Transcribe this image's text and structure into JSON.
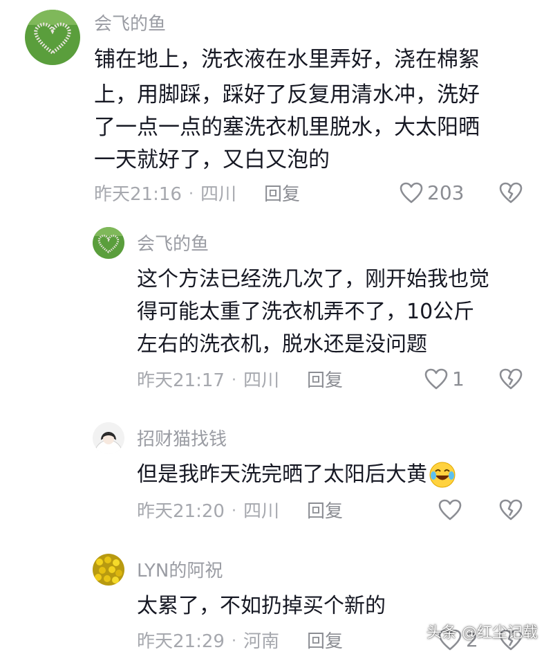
{
  "comments": [
    {
      "name": "会飞的鱼",
      "lines": [
        "铺在地上，洗衣液在水里弄好，浇在棉絮",
        "上，用脚踩，踩好了反复用清水冲，洗好",
        "了一点一点的塞洗衣机里脱水，大太阳晒",
        "一天就好了，又白又泡的"
      ],
      "time": "昨天21:16",
      "location": "四川",
      "reply_label": "回复",
      "likes": "203"
    },
    {
      "name": "会飞的鱼",
      "lines": [
        "这个方法已经洗几次了，刚开始我也觉",
        "得可能太重了洗衣机弄不了，10公斤",
        "左右的洗衣机，脱水还是没问题"
      ],
      "time": "昨天21:17",
      "location": "四川",
      "reply_label": "回复",
      "likes": "1"
    },
    {
      "name": "招财猫找钱",
      "lines": [
        "但是我昨天洗完晒了太阳后大黄"
      ],
      "time": "昨天21:20",
      "location": "四川",
      "reply_label": "回复",
      "likes": ""
    },
    {
      "name": "LYN的阿祝",
      "lines": [
        "太累了，不如扔掉买个新的"
      ],
      "time": "昨天21:29",
      "location": "河南",
      "reply_label": "回复",
      "likes": "2"
    }
  ],
  "watermark": "头条 @红尘记载",
  "icons": {
    "like": "heart-outline-icon",
    "dislike": "broken-heart-icon",
    "emoji": "laughing-tears-emoji"
  },
  "colors": {
    "text": "#161823",
    "name": "#9a9ca3",
    "meta": "#a6a8ae",
    "icon": "#8b8d93"
  }
}
